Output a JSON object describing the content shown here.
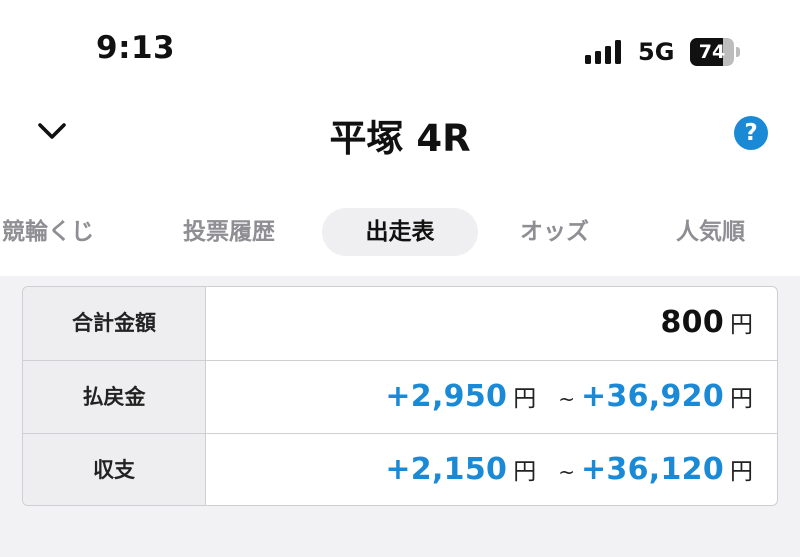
{
  "status_bar": {
    "time": "9:13",
    "network": "5G",
    "battery": "74",
    "battery_level": 0.74
  },
  "header": {
    "title": "平塚 4R",
    "back_icon": "chevron-down-icon",
    "help_label": "?",
    "help_color": "#1a8ad6"
  },
  "tabs": [
    {
      "label": "競輪くじ",
      "active": false
    },
    {
      "label": "投票履歴",
      "active": false
    },
    {
      "label": "出走表",
      "active": true
    },
    {
      "label": "オッズ",
      "active": false
    },
    {
      "label": "人気順",
      "active": false
    }
  ],
  "summary": {
    "total": {
      "label": "合計金額",
      "amount": "800",
      "unit": "円"
    },
    "payout": {
      "label": "払戻金",
      "min": "+2,950",
      "min_unit": "円",
      "tilde": "~",
      "max": "+36,920",
      "max_unit": "円"
    },
    "balance": {
      "label": "収支",
      "min": "+2,150",
      "min_unit": "円",
      "tilde": "~",
      "max": "+36,120",
      "max_unit": "円"
    }
  },
  "colors": {
    "accent_blue": "#1a8ad6",
    "inactive_tab": "#8e8e93"
  }
}
